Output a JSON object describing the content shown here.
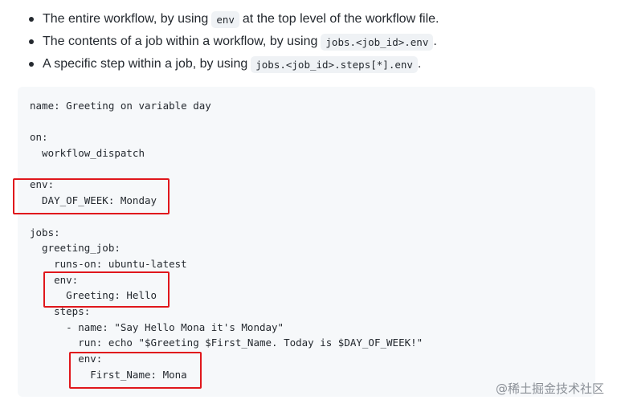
{
  "bullets": [
    {
      "before": "The entire workflow, by using",
      "code": "env",
      "after": "at the top level of the workflow file."
    },
    {
      "before": "The contents of a job within a workflow, by using",
      "code": "jobs.<job_id>.env",
      "after": "."
    },
    {
      "before": "A specific step within a job, by using",
      "code": "jobs.<job_id>.steps[*].env",
      "after": "."
    }
  ],
  "code_lines": [
    "name: Greeting on variable day",
    "",
    "on:",
    "  workflow_dispatch",
    "",
    "env:",
    "  DAY_OF_WEEK: Monday",
    "",
    "jobs:",
    "  greeting_job:",
    "    runs-on: ubuntu-latest",
    "    env:",
    "      Greeting: Hello",
    "    steps:",
    "      - name: \"Say Hello Mona it's Monday\"",
    "        run: echo \"$Greeting $First_Name. Today is $DAY_OF_WEEK!\"",
    "        env:",
    "          First_Name: Mona"
  ],
  "highlight_color": "#e0171c",
  "watermark": "@稀土掘金技术社区"
}
